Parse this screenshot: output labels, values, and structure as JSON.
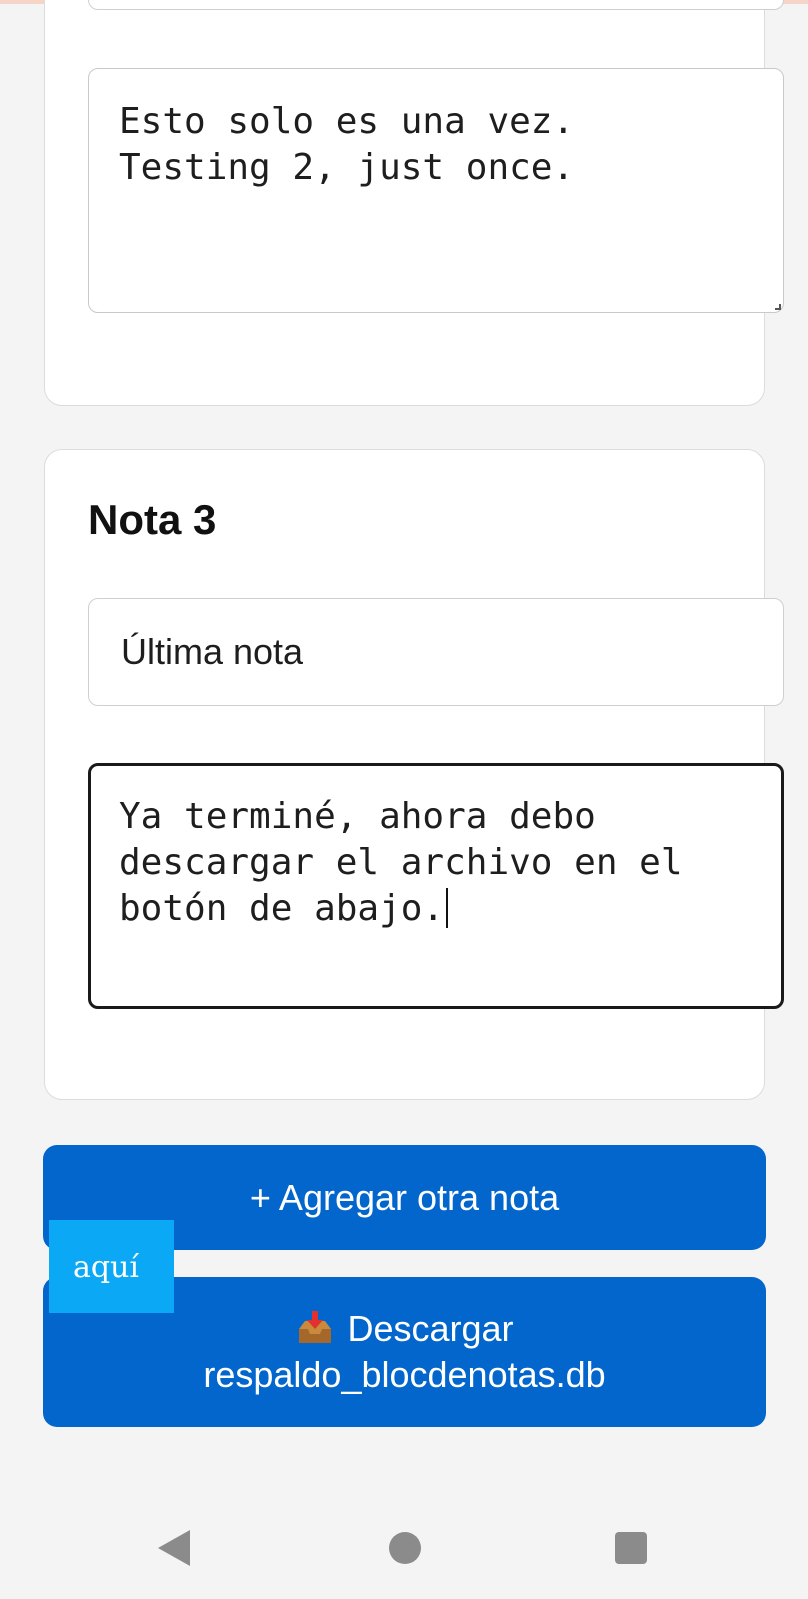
{
  "notes": [
    {
      "content": "Esto solo es una vez.\nTesting 2, just once."
    },
    {
      "title_label": "Nota 3",
      "title_value": "Última nota",
      "content": "Ya terminé, ahora debo descargar el archivo en el botón de abajo."
    }
  ],
  "buttons": {
    "add_note": "+ Agregar otra nota",
    "download_prefix": "Descargar",
    "download_filename": "respaldo_blocdenotas.db"
  },
  "overlay": {
    "label": "aquí"
  },
  "icons": {
    "download": "inbox-tray-icon",
    "nav_back": "back-triangle-icon",
    "nav_home": "home-circle-icon",
    "nav_recents": "recents-square-icon"
  },
  "colors": {
    "button_bg": "#0366cc",
    "overlay_bg": "#0aa8f5",
    "page_bg": "#f4f4f4"
  }
}
